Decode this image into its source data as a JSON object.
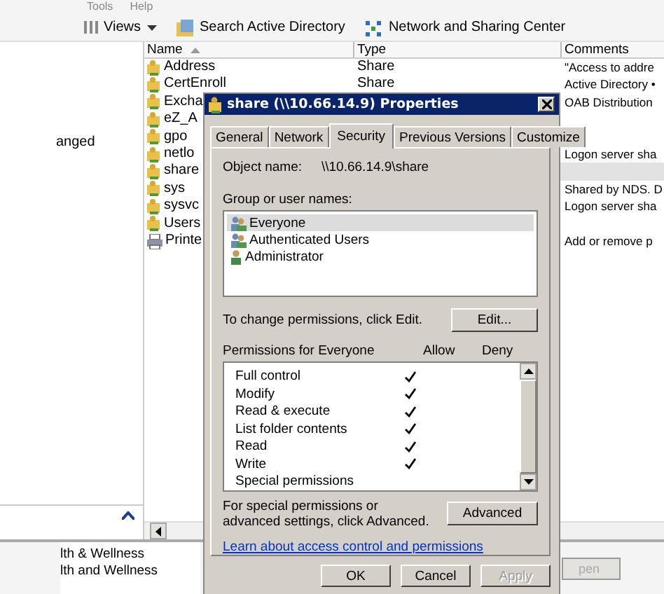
{
  "menu": [
    "Tools",
    "Help"
  ],
  "toolbar": [
    {
      "label": "Views",
      "kind": "views"
    },
    {
      "label": "Search Active Directory",
      "kind": "directory"
    },
    {
      "label": "Network and Sharing Center",
      "kind": "network"
    }
  ],
  "left_pane": {
    "text": "anged"
  },
  "columns": [
    {
      "label": "Name",
      "sorted": true
    },
    {
      "label": "Type",
      "sorted": false
    },
    {
      "label": "Comments",
      "sorted": false
    }
  ],
  "rows": [
    {
      "name": "Address",
      "type": "Share",
      "comments": "\"Access to addre",
      "kind": "share",
      "selected": false
    },
    {
      "name": "CertEnroll",
      "type": "Share",
      "comments": "Active Directory •",
      "kind": "share",
      "selected": false
    },
    {
      "name": "Excha",
      "comments": "OAB Distribution",
      "kind": "share",
      "selected": false
    },
    {
      "name": "eZ_A",
      "kind": "share",
      "selected": false
    },
    {
      "name": "gpo",
      "kind": "share",
      "selected": false
    },
    {
      "name": "netlo",
      "comments": "Logon server sha",
      "kind": "share",
      "selected": false
    },
    {
      "name": "share",
      "kind": "share",
      "selected": true
    },
    {
      "name": "sys",
      "comments": "Shared by NDS. D",
      "kind": "share",
      "selected": false
    },
    {
      "name": "sysvc",
      "comments": "Logon server sha",
      "kind": "share",
      "selected": false
    },
    {
      "name": "Users",
      "kind": "share",
      "selected": false
    },
    {
      "name": "Printe",
      "comments": "Add or remove p",
      "kind": "printer",
      "selected": false
    }
  ],
  "bottom_pane": {
    "lines": [
      "lth & Wellness",
      "lth and Wellness"
    ]
  },
  "open_button": {
    "label": "pen",
    "disabled": true
  },
  "dialog": {
    "title": "share (\\\\10.66.14.9) Properties",
    "tabs": [
      {
        "label": "General",
        "selected": false
      },
      {
        "label": "Network",
        "selected": false
      },
      {
        "label": "Security",
        "selected": true
      },
      {
        "label": "Previous Versions",
        "selected": false
      },
      {
        "label": "Customize",
        "selected": false
      }
    ],
    "object_name_label": "Object name:",
    "object_name": "\\\\10.66.14.9\\share",
    "groups_label": "Group or user names:",
    "groups": [
      {
        "name": "Everyone",
        "kind": "group",
        "selected": true
      },
      {
        "name": "Authenticated Users",
        "kind": "group",
        "selected": false
      },
      {
        "name": "Administrator",
        "kind": "user",
        "selected": false
      }
    ],
    "edit_hint": "To change permissions, click Edit.",
    "edit_button": "Edit...",
    "permissions_label": "Permissions for Everyone",
    "allow_label": "Allow",
    "deny_label": "Deny",
    "permissions": [
      {
        "name": "Full control",
        "allow": true
      },
      {
        "name": "Modify",
        "allow": true
      },
      {
        "name": "Read & execute",
        "allow": true
      },
      {
        "name": "List folder contents",
        "allow": true
      },
      {
        "name": "Read",
        "allow": true
      },
      {
        "name": "Write",
        "allow": true
      },
      {
        "name": "Special permissions",
        "allow": false
      }
    ],
    "advanced_hint": "For special permissions or advanced settings, click Advanced.",
    "advanced_button": "Advanced",
    "link": "Learn about access control and permissions",
    "buttons": [
      {
        "label": "OK",
        "disabled": false
      },
      {
        "label": "Cancel",
        "disabled": false
      },
      {
        "label": "Apply",
        "disabled": true
      }
    ]
  }
}
